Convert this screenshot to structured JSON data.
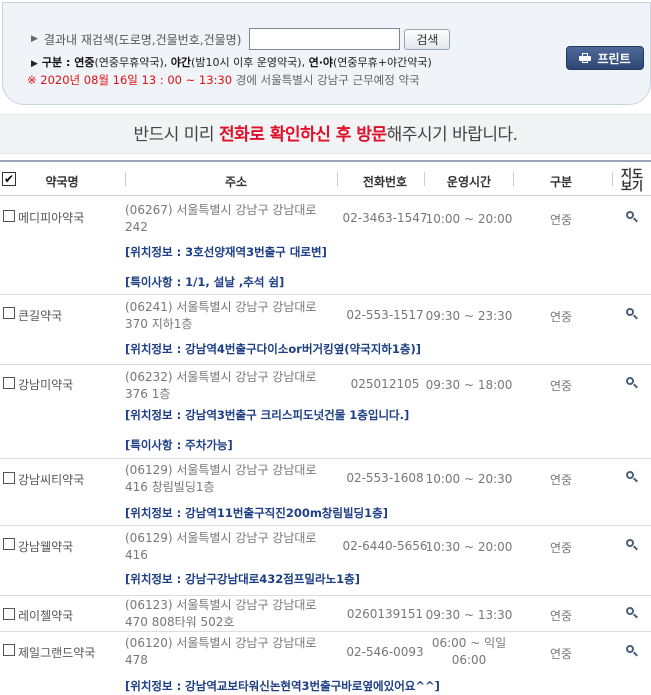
{
  "search": {
    "label": "결과내 재검색(도로명,건물번호,건물명)",
    "placeholder": "",
    "button": "검색"
  },
  "legend": {
    "prefix": "구분 : ",
    "items": [
      {
        "name": "연중",
        "desc": "(연중무휴약국)"
      },
      {
        "name": "야간",
        "desc": "(밤10시 이후 운영약국)"
      },
      {
        "name": "연·야",
        "desc": "(연중무휴+야간약국)"
      }
    ]
  },
  "notice": {
    "date": "※ 2020년 08월 16일 13 : 00 ~ 13:30",
    "rest": "경에  서울특별시  강남구  근무예정 약국"
  },
  "print_button": "프린트",
  "banner": {
    "before": "반드시 미리 ",
    "highlight": "전화로 확인하신 후 방문",
    "after": "해주시기 바랍니다."
  },
  "columns": {
    "name": "약국명",
    "address": "주소",
    "phone": "전화번호",
    "hours": "운영시간",
    "kind": "구분",
    "map1": "지도",
    "map2": "보기"
  },
  "rows": [
    {
      "name": "메디피아약국",
      "addr1": "(06267) 서울특별시 강남구 강남대로",
      "addr2": "242",
      "phone": "02-3463-1547",
      "hours1": "10:00 ~ 20:00",
      "hours2": "",
      "kind": "연중",
      "info": [
        "[위치정보 : 3호선양재역3번출구 대로변]",
        "[특이사항 : 1/1, 설날 ,추석 쉼]"
      ]
    },
    {
      "name": "큰길약국",
      "addr1": "(06241) 서울특별시 강남구 강남대로",
      "addr2": "370 지하1층",
      "phone": "02-553-1517",
      "hours1": "09:30 ~ 23:30",
      "hours2": "",
      "kind": "연중",
      "info": [
        "[위치정보 : 강남역4번출구다이소or버거킹옆(약국지하1층)]"
      ]
    },
    {
      "name": "강남미약국",
      "addr1": "(06232) 서울특별시 강남구 강남대로",
      "addr2": "376 1층",
      "phone": "025012105",
      "hours1": "09:30 ~ 18:00",
      "hours2": "",
      "kind": "연중",
      "info": [
        "[위치정보 : 강남역3번출구 크리스피도넛건물 1층입니다.]",
        "[특이사항 : 주차가능]"
      ]
    },
    {
      "name": "강남씨티약국",
      "addr1": "(06129) 서울특별시 강남구 강남대로",
      "addr2": "416 창림빌딩1층",
      "phone": "02-553-1608",
      "hours1": "10:00 ~ 20:30",
      "hours2": "",
      "kind": "연중",
      "info": [
        "[위치정보 : 강남역11번출구직진200m창림빌딩1층]"
      ]
    },
    {
      "name": "강남웰약국",
      "addr1": "(06129) 서울특별시 강남구 강남대로",
      "addr2": "416",
      "phone": "02-6440-5656",
      "hours1": "10:30 ~ 20:00",
      "hours2": "",
      "kind": "연중",
      "info": [
        "[위치정보 : 강남구강남대로432점프밀라노1층]"
      ]
    },
    {
      "name": "레이첼약국",
      "addr1": "(06123) 서울특별시 강남구 강남대로",
      "addr2": "470 808타워 502호",
      "phone": "0260139151",
      "hours1": "09:30 ~ 13:30",
      "hours2": "",
      "kind": "연중",
      "info": []
    },
    {
      "name": "제일그랜드약국",
      "addr1": "(06120) 서울특별시 강남구 강남대로",
      "addr2": "478",
      "phone": "02-546-0093",
      "hours1": "06:00 ~ 익일",
      "hours2": "06:00",
      "kind": "연중",
      "info": [
        "[위치정보 : 강남역교보타워신논현역3번출구바로옆에있어요^^]"
      ]
    }
  ]
}
